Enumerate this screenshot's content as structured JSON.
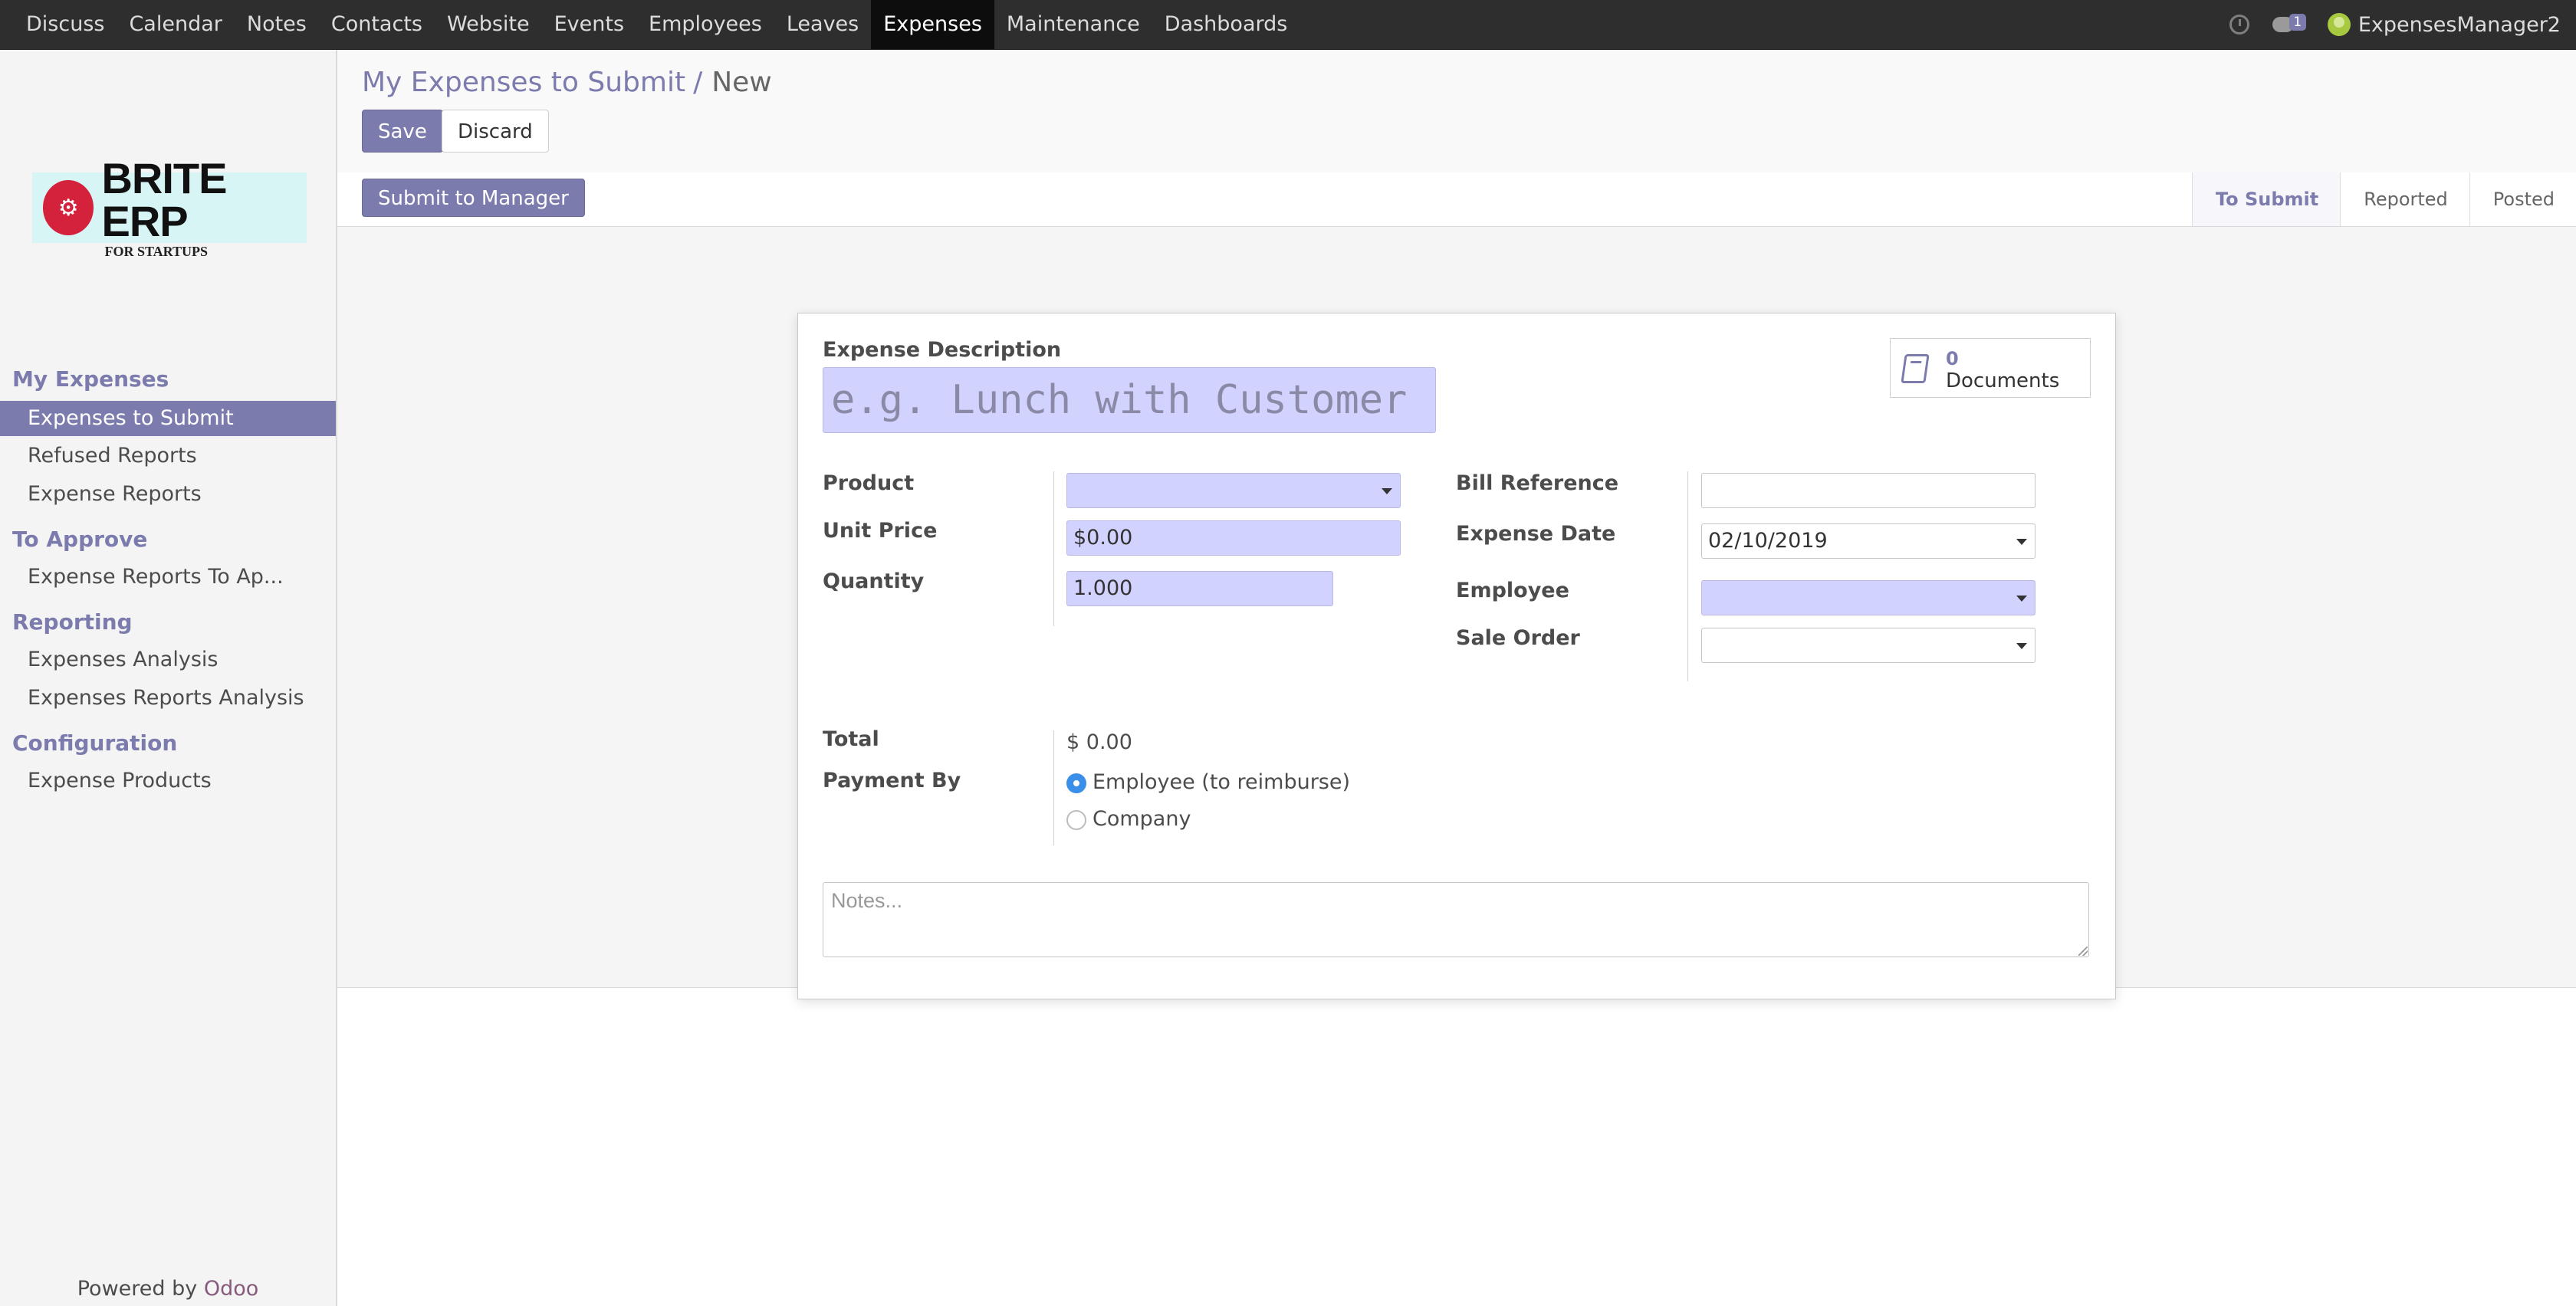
{
  "topbar": {
    "menu": [
      "Discuss",
      "Calendar",
      "Notes",
      "Contacts",
      "Website",
      "Events",
      "Employees",
      "Leaves",
      "Expenses",
      "Maintenance",
      "Dashboards"
    ],
    "active": "Expenses",
    "chat_count": "1",
    "user": "ExpensesManager2"
  },
  "logo": {
    "mark": "⚙",
    "title": "BRITE ERP",
    "subtitle": "FOR STARTUPS"
  },
  "sidebar": {
    "my_expenses": "My Expenses",
    "expenses_to_submit": "Expenses to Submit",
    "refused_reports": "Refused Reports",
    "expense_reports": "Expense Reports",
    "to_approve": "To Approve",
    "expense_reports_to_approve": "Expense Reports To Ap...",
    "reporting": "Reporting",
    "expenses_analysis": "Expenses Analysis",
    "expenses_reports_analysis": "Expenses Reports Analysis",
    "configuration": "Configuration",
    "expense_products": "Expense Products",
    "powered_by": "Powered by",
    "odoo": "Odoo"
  },
  "breadcrumb": {
    "parent": "My Expenses to Submit",
    "separator": "/",
    "current": "New"
  },
  "buttons": {
    "save": "Save",
    "discard": "Discard",
    "submit": "Submit to Manager"
  },
  "stages": [
    "To Submit",
    "Reported",
    "Posted"
  ],
  "current_stage": "To Submit",
  "form": {
    "description_label": "Expense Description",
    "description_placeholder": "e.g. Lunch with Customer",
    "documents_count": "0",
    "documents_label": "Documents",
    "product_label": "Product",
    "product_value": "",
    "unit_price_label": "Unit Price",
    "unit_price_value": "$0.00",
    "quantity_label": "Quantity",
    "quantity_value": "1.000",
    "bill_reference_label": "Bill Reference",
    "bill_reference_value": "",
    "expense_date_label": "Expense Date",
    "expense_date_value": "02/10/2019",
    "employee_label": "Employee",
    "employee_value": "",
    "sale_order_label": "Sale Order",
    "sale_order_value": "",
    "total_label": "Total",
    "total_value": "$ 0.00",
    "payment_by_label": "Payment By",
    "payment_options": [
      "Employee (to reimburse)",
      "Company"
    ],
    "payment_selected": "Employee (to reimburse)",
    "notes_placeholder": "Notes..."
  },
  "colors": {
    "accent": "#7c7bad",
    "required_field": "#d2d2ff",
    "topbar": "#2e2e2e",
    "radio_on": "#3b8fe8"
  }
}
